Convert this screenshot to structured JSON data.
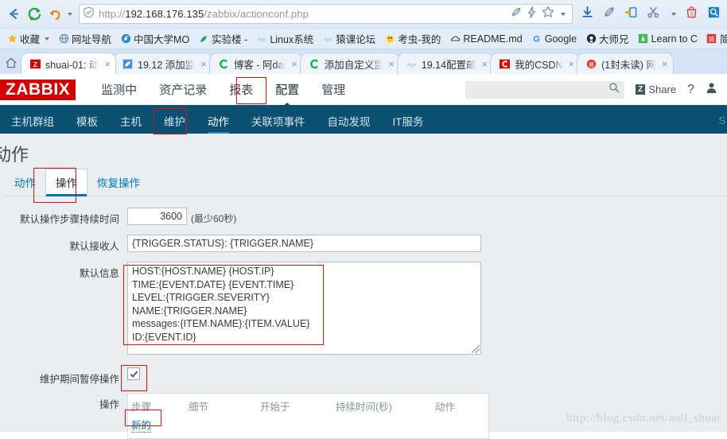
{
  "browser": {
    "url_prefix": "http://",
    "url_host": "192.168.176.135",
    "url_path": "/zabbix/actionconf.php",
    "nav": [
      {
        "name": "back-button",
        "glyph": "←"
      },
      {
        "name": "reload-button",
        "glyph": "↻"
      },
      {
        "name": "undo-button",
        "glyph": "↩"
      }
    ],
    "url_icons": [
      "pen-icon",
      "lightning-icon",
      "star-icon",
      "chevron-down-icon"
    ],
    "toolbar_icons": [
      "download-icon",
      "leaf-icon",
      "cast-icon",
      "scissors-icon",
      "chevron-down-icon",
      "shop-icon",
      "magnifier-app-icon"
    ]
  },
  "bookmarks": [
    {
      "label": "收藏",
      "icon": "star-icon",
      "has_caret": true
    },
    {
      "label": "网址导航",
      "icon": "globe-icon"
    },
    {
      "label": "中国大学MO",
      "icon": "mooc-icon"
    },
    {
      "label": "实验楼 -",
      "icon": "leaf-icon"
    },
    {
      "label": "Linux系统",
      "icon": "aps-icon"
    },
    {
      "label": "猿课论坛",
      "icon": "aps-icon"
    },
    {
      "label": "考虫-我的",
      "icon": "chick-icon"
    },
    {
      "label": "README.md",
      "icon": "cloud-icon"
    },
    {
      "label": "Google",
      "icon": "google-icon"
    },
    {
      "label": "大师兄",
      "icon": "github-icon"
    },
    {
      "label": "Learn to C",
      "icon": "learn-icon"
    },
    {
      "label": "简",
      "icon": "jian-icon"
    }
  ],
  "tabs": [
    {
      "label": "shuai-01: 动",
      "icon": "zabbix-icon",
      "active": true
    },
    {
      "label": "19.12 添加监",
      "icon": "evernote-icon",
      "active": false
    },
    {
      "label": "博客 - 阿dai",
      "icon": "csdn-c-icon",
      "active": false
    },
    {
      "label": "添加自定义监",
      "icon": "csdn-c-icon",
      "active": false
    },
    {
      "label": "19.14配置邮",
      "icon": "aps-icon",
      "active": false
    },
    {
      "label": "我的CSDN",
      "icon": "csdn-red-icon",
      "active": false
    },
    {
      "label": "(1封未读) 网",
      "icon": "mail-icon",
      "active": false
    }
  ],
  "zabbix": {
    "logo": "ZABBIX",
    "menu": [
      {
        "label": "监测中",
        "selected": false
      },
      {
        "label": "资产记录",
        "selected": false
      },
      {
        "label": "报表",
        "selected": false
      },
      {
        "label": "配置",
        "selected": true
      },
      {
        "label": "管理",
        "selected": false
      }
    ],
    "search_placeholder": "",
    "share_label": "Share",
    "share_badge": "Z",
    "help_label": "?",
    "subnav": [
      {
        "label": "主机群组",
        "selected": false
      },
      {
        "label": "模板",
        "selected": false
      },
      {
        "label": "主机",
        "selected": false
      },
      {
        "label": "维护",
        "selected": false
      },
      {
        "label": "动作",
        "selected": true
      },
      {
        "label": "关联项事件",
        "selected": false
      },
      {
        "label": "自动发现",
        "selected": false
      },
      {
        "label": "IT服务",
        "selected": false
      }
    ],
    "subnav_overflow": "S"
  },
  "page": {
    "title": "动作",
    "tabs": [
      {
        "label": "动作",
        "selected": false
      },
      {
        "label": "操作",
        "selected": true
      },
      {
        "label": "恢复操作",
        "selected": false
      }
    ],
    "fields": {
      "default_step_duration_label": "默认操作步骤持续时间",
      "default_step_duration_value": "3600",
      "default_step_duration_hint": "(最少60秒)",
      "default_subject_label": "默认接收人",
      "default_subject_value": "{TRIGGER.STATUS}: {TRIGGER.NAME}",
      "default_message_label": "默认信息",
      "default_message_value": "HOST:{HOST.NAME} {HOST.IP}\nTIME:{EVENT.DATE} {EVENT.TIME}\nLEVEL:{TRIGGER.SEVERITY}\nNAME:{TRIGGER.NAME}\nmessages:{ITEM.NAME}:{ITEM.VALUE}\nID:{EVENT.ID}",
      "pause_maintenance_label": "维护期间暂停操作",
      "pause_maintenance_checked": true,
      "operations_label": "操作"
    },
    "operations_table": {
      "headers": [
        "步骤",
        "细节",
        "开始于",
        "持续时间(秒)",
        "动作"
      ],
      "new_link": "新的"
    },
    "watermark": "http://blog.csdn.net/aoli_shuai"
  }
}
